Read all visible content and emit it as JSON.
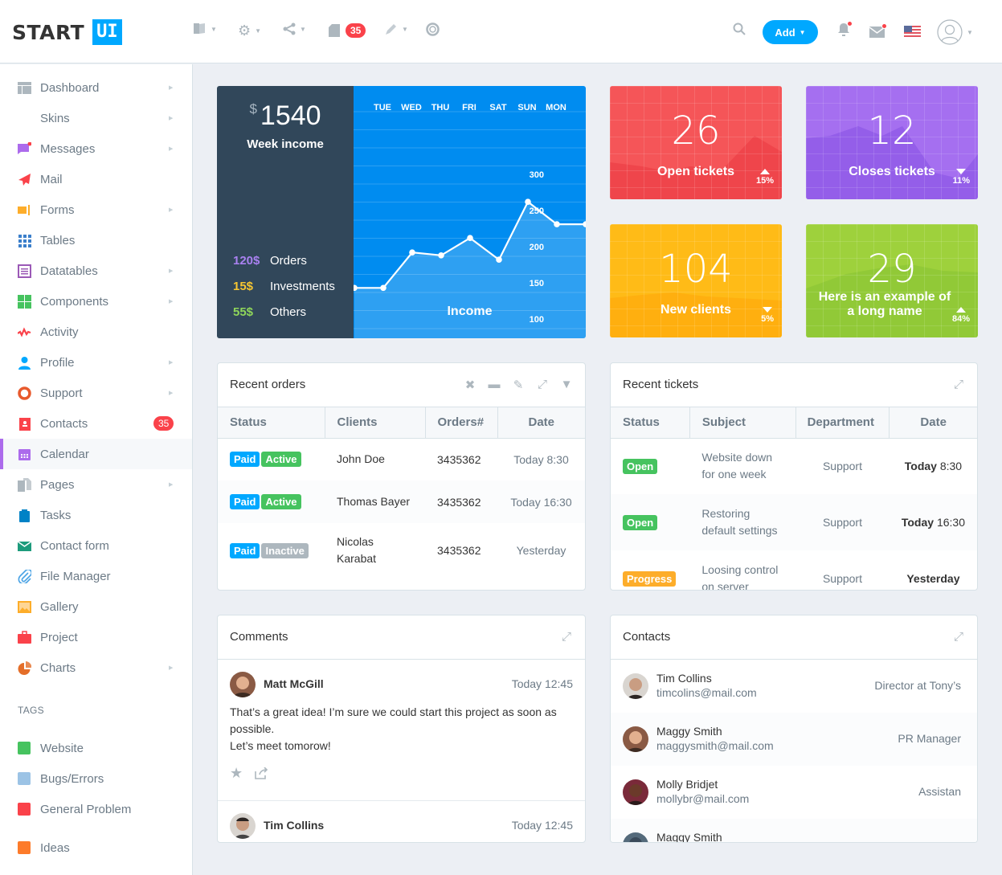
{
  "header": {
    "logo_start": "START",
    "logo_ui": "UI",
    "toolbar_icons": [
      "book-icon",
      "gear-icon",
      "share-icon",
      "file-icon",
      "pencil-icon",
      "lifebuoy-icon"
    ],
    "files_badge": "35",
    "add_label": "Add",
    "search_icon": "search-icon",
    "notifications_icon": "bell-icon",
    "messages_icon": "mail-icon",
    "language_flag": "us-flag-icon",
    "user_icon": "user-avatar-icon"
  },
  "sidebar": {
    "items": [
      {
        "label": "Dashboard",
        "icon": "dashboard-icon",
        "color": "#adb7be",
        "arrow": true
      },
      {
        "label": "Skins",
        "icon": "drop-icon",
        "color": "#e46e29",
        "arrow": true
      },
      {
        "label": "Messages",
        "icon": "messages-icon",
        "color": "#ac6bec",
        "arrow": true
      },
      {
        "label": "Mail",
        "icon": "paper-plane-icon",
        "color": "#fa424a",
        "arrow": false
      },
      {
        "label": "Forms",
        "icon": "forms-icon",
        "color": "#fdad2a",
        "arrow": true
      },
      {
        "label": "Tables",
        "icon": "grid-icon",
        "color": "#3b7fcb",
        "arrow": false
      },
      {
        "label": "Datatables",
        "icon": "list-icon",
        "color": "#9b59b6",
        "arrow": true
      },
      {
        "label": "Components",
        "icon": "components-icon",
        "color": "#46c35f",
        "arrow": true
      },
      {
        "label": "Activity",
        "icon": "activity-icon",
        "color": "#fa424a",
        "arrow": false
      },
      {
        "label": "Profile",
        "icon": "user-icon",
        "color": "#00a8ff",
        "arrow": true
      },
      {
        "label": "Support",
        "icon": "lifebuoy-icon",
        "color": "#e85a2d",
        "arrow": true
      },
      {
        "label": "Contacts",
        "icon": "contacts-icon",
        "color": "#fa424a",
        "arrow": false,
        "badge": "35"
      },
      {
        "label": "Calendar",
        "icon": "calendar-icon",
        "color": "#ac6bec",
        "arrow": false,
        "active": true
      },
      {
        "label": "Pages",
        "icon": "pages-icon",
        "color": "#adb7be",
        "arrow": true
      },
      {
        "label": "Tasks",
        "icon": "clipboard-icon",
        "color": "#0082c6",
        "arrow": false
      },
      {
        "label": "Contact form",
        "icon": "envelope-icon",
        "color": "#1d9b7c",
        "arrow": false
      },
      {
        "label": "File Manager",
        "icon": "paperclip-icon",
        "color": "#4aa3e5",
        "arrow": false
      },
      {
        "label": "Gallery",
        "icon": "image-icon",
        "color": "#fdad2a",
        "arrow": false
      },
      {
        "label": "Project",
        "icon": "briefcase-icon",
        "color": "#fa424a",
        "arrow": false
      },
      {
        "label": "Charts",
        "icon": "pie-chart-icon",
        "color": "#e46e29",
        "arrow": true
      }
    ],
    "tags_title": "TAGS",
    "tags": [
      {
        "label": "Website",
        "color": "#46c35f"
      },
      {
        "label": "Bugs/Errors",
        "color": "#9cc3e5"
      },
      {
        "label": "General Problem",
        "color": "#fa424a"
      },
      {
        "label": "Ideas",
        "color": "#fd7b2a"
      }
    ]
  },
  "income": {
    "currency": "$",
    "amount": "1540",
    "title": "Week income",
    "legend": [
      {
        "value": "120$",
        "label": "Orders",
        "color": "#a981f0"
      },
      {
        "value": "15$",
        "label": "Investments",
        "color": "#f7c631"
      },
      {
        "value": "55$",
        "label": "Others",
        "color": "#8fd65a"
      }
    ],
    "chart_label": "Income"
  },
  "chart_data": {
    "type": "area",
    "title": "Income",
    "categories": [
      "TUE",
      "WED",
      "THU",
      "FRI",
      "SAT",
      "SUN",
      "MON"
    ],
    "x_points": [
      "",
      "TUE",
      "WED",
      "THU",
      "FRI",
      "SAT",
      "SUN",
      "MON",
      ""
    ],
    "values": [
      143,
      143,
      192,
      188,
      212,
      182,
      262,
      231,
      231
    ],
    "yticks": [
      300,
      250,
      200,
      150,
      100,
      50
    ],
    "ylim": [
      35,
      335
    ],
    "grid": true,
    "xlabel": "",
    "ylabel": ""
  },
  "tiles": [
    {
      "value": "26",
      "label": "Open tickets",
      "pct": "15%",
      "trend": "up",
      "color": "#f55558",
      "dark": "#ec3f46"
    },
    {
      "value": "12",
      "label": "Closes tickets",
      "pct": "11%",
      "trend": "down",
      "color": "#a56ff0",
      "dark": "#8d57e6"
    },
    {
      "value": "104",
      "label": "New clients",
      "pct": "5%",
      "trend": "down",
      "color": "#ffbb17",
      "dark": "#ffaa0d"
    },
    {
      "value": "29",
      "label": "Here is an example of a long name",
      "pct": "84%",
      "trend": "up",
      "color": "#9ed13c",
      "dark": "#8bc634"
    }
  ],
  "orders": {
    "title": "Recent orders",
    "tools": [
      "close-icon",
      "minimize-icon",
      "edit-icon",
      "expand-icon",
      "filter-icon"
    ],
    "columns": [
      "Status",
      "Clients",
      "Orders#",
      "Date"
    ],
    "rows": [
      {
        "paid": "Paid",
        "state": "Active",
        "state_type": "green",
        "client": "John Doe",
        "order": "3435362",
        "date": "Today 8:30"
      },
      {
        "paid": "Paid",
        "state": "Active",
        "state_type": "green",
        "client": "Thomas Bayer",
        "order": "3435362",
        "date": "Today 16:30"
      },
      {
        "paid": "Paid",
        "state": "Inactive",
        "state_type": "grey",
        "client": "Nicolas Karabat",
        "order": "3435362",
        "date": "Yesterday"
      }
    ]
  },
  "tickets": {
    "title": "Recent tickets",
    "columns": [
      "Status",
      "Subject",
      "Department",
      "Date"
    ],
    "rows": [
      {
        "status": "Open",
        "status_type": "green",
        "subject": "Website down for one week",
        "department": "Support",
        "date_bold": "Today",
        "date_time": "8:30"
      },
      {
        "status": "Open",
        "status_type": "green",
        "subject": "Restoring default settings",
        "department": "Support",
        "date_bold": "Today",
        "date_time": "16:30"
      },
      {
        "status": "Progress",
        "status_type": "orange",
        "subject": "Loosing control on server",
        "department": "Support",
        "date_bold": "Yesterday",
        "date_time": ""
      }
    ]
  },
  "comments": {
    "title": "Comments",
    "items": [
      {
        "name": "Matt McGill",
        "time": "Today 12:45",
        "text_line1": "That’s a great idea! I’m sure we could start this project as soon as possible.",
        "text_line2": "Let’s meet tomorow!"
      },
      {
        "name": "Tim Collins",
        "time": "Today 12:45"
      }
    ]
  },
  "contacts": {
    "title": "Contacts",
    "items": [
      {
        "name": "Tim Collins",
        "email": "timcolins@mail.com",
        "role": "Director at Tony’s"
      },
      {
        "name": "Maggy Smith",
        "email": "maggysmith@mail.com",
        "role": "PR Manager"
      },
      {
        "name": "Molly Bridjet",
        "email": "mollybr@mail.com",
        "role": "Assistan"
      },
      {
        "name": "Maggy Smith",
        "email": "",
        "role": ""
      }
    ]
  }
}
